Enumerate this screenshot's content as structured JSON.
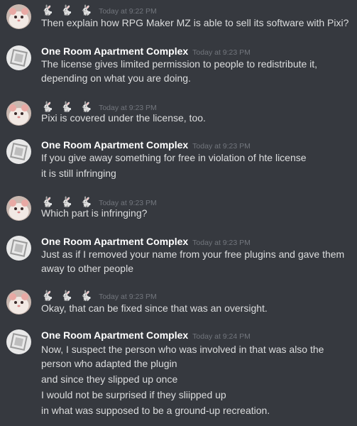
{
  "users": {
    "bunny": {
      "display": "🐇 🐇 🐇",
      "avatar_icon": "hamster-avatar-icon"
    },
    "apartment": {
      "display": "One Room Apartment Complex",
      "avatar_icon": "badge-avatar-icon"
    }
  },
  "messages": [
    {
      "author": "🐇 🐇 🐇",
      "time": "Today at 9:22 PM",
      "lines": [
        "Then explain how RPG Maker MZ is able to sell its software with Pixi?"
      ]
    },
    {
      "author": "One Room Apartment Complex",
      "time": "Today at 9:23 PM",
      "lines": [
        "The license gives limited permission to people to redistribute it, depending on what you are doing."
      ]
    },
    {
      "author": "🐇 🐇 🐇",
      "time": "Today at 9:23 PM",
      "lines": [
        "Pixi is covered under the license, too."
      ]
    },
    {
      "author": "One Room Apartment Complex",
      "time": "Today at 9:23 PM",
      "lines": [
        "If you give away something for free in violation of hte license",
        "it is still infringing"
      ]
    },
    {
      "author": "🐇 🐇 🐇",
      "time": "Today at 9:23 PM",
      "lines": [
        "Which part is infringing?"
      ]
    },
    {
      "author": "One Room Apartment Complex",
      "time": "Today at 9:23 PM",
      "lines": [
        "Just as if I removed your name from your free plugins and gave them away to other people"
      ]
    },
    {
      "author": "🐇 🐇 🐇",
      "time": "Today at 9:23 PM",
      "lines": [
        "Okay, that can be fixed since that was an oversight."
      ]
    },
    {
      "author": "One Room Apartment Complex",
      "time": "Today at 9:24 PM",
      "lines": [
        "Now, I suspect the person who was involved in that was also the person who adapted the plugin",
        "and since they slipped up once",
        "I would not be surprised if they sliipped up",
        "in what was supposed to be a ground-up recreation."
      ]
    }
  ],
  "colors": {
    "background": "#36393f",
    "name": "#ffffff",
    "text": "#dcddde",
    "timestamp": "#72767d"
  }
}
